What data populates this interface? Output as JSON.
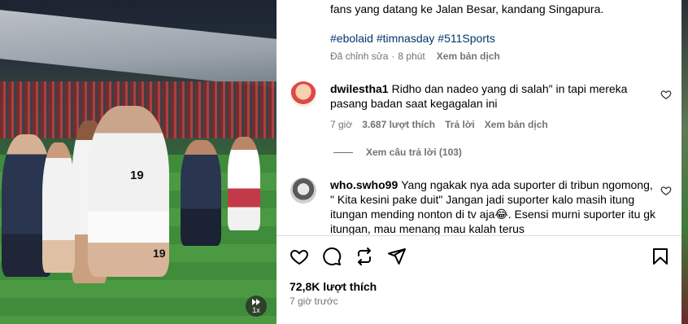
{
  "media": {
    "jersey_number": "19",
    "jersey_number_short": "19",
    "speed_label": "1x",
    "speed_icon": "speed-icon"
  },
  "caption": {
    "text": "fans yang datang ke Jalan Besar, kandang Singapura.",
    "hashtags": "#ebolaid #timnasday #511Sports",
    "edited": "Đã chỉnh sửa",
    "dot": "·",
    "age": "8 phút",
    "translate": "Xem bản dịch"
  },
  "comments": [
    {
      "username": "dwilestha1",
      "text": "Ridho dan nadeo yang di salah\" in tapi mereka pasang badan saat kegagalan ini",
      "time": "7 giờ",
      "likes": "3.687 lượt thích",
      "reply": "Trả lời",
      "translate": "Xem bản dịch",
      "view_replies": "Xem câu trả lời (103)"
    },
    {
      "username": "who.swho99",
      "text": "Yang ngakak nya ada suporter di tribun ngomong, \" Kita kesini pake duit\" Jangan jadi suporter kalo masih itung itungan mending nonton di tv aja😂. Esensi murni suporter itu gk itungan, mau menang mau kalah terus"
    }
  ],
  "actions": {
    "like_icon": "heart-icon",
    "comment_icon": "comment-icon",
    "repost_icon": "repost-icon",
    "share_icon": "share-icon",
    "save_icon": "bookmark-icon"
  },
  "footer": {
    "likes": "72,8K lượt thích",
    "time": "7 giờ trước"
  },
  "colors": {
    "hashtag": "#00376b",
    "secondary_text": "#737373",
    "divider": "#dbdbdb"
  }
}
